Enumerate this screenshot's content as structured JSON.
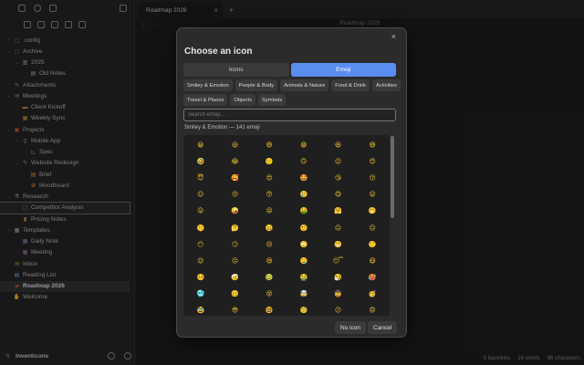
{
  "sidebar": {
    "vault_name": "Inventicons",
    "tree": [
      {
        "label": ".config",
        "arrow": "›",
        "glyph": "▢",
        "color": "#8a8a8a",
        "indent": 0
      },
      {
        "label": "Archive",
        "arrow": "⌄",
        "glyph": "▢",
        "color": "#8a8a8a",
        "indent": 0
      },
      {
        "label": "2025",
        "arrow": "⌄",
        "glyph": "▥",
        "color": "#b8b8b8",
        "indent": 1
      },
      {
        "label": "Old Notes",
        "arrow": "",
        "glyph": "▤",
        "color": "#b8b8b8",
        "indent": 2
      },
      {
        "label": "Attachments",
        "arrow": "›",
        "glyph": "✎",
        "color": "#8ab0d8",
        "indent": 0
      },
      {
        "label": "Meetings",
        "arrow": "⌄",
        "glyph": "✉",
        "color": "#8a9ad8",
        "indent": 0
      },
      {
        "label": "Client Kickoff",
        "arrow": "",
        "glyph": "▬",
        "color": "#d8a040",
        "indent": 1
      },
      {
        "label": "Weekly Sync",
        "arrow": "",
        "glyph": "▦",
        "color": "#d8a040",
        "indent": 1
      },
      {
        "label": "Projects",
        "arrow": "⌄",
        "glyph": "▣",
        "color": "#d86040",
        "indent": 0
      },
      {
        "label": "Mobile App",
        "arrow": "⌄",
        "glyph": "▯",
        "color": "#b8b8b8",
        "indent": 1
      },
      {
        "label": "Spec",
        "arrow": "",
        "glyph": "◺",
        "color": "#8ab0d8",
        "indent": 2
      },
      {
        "label": "Website Redesign",
        "arrow": "⌄",
        "glyph": "✎",
        "color": "#8ab0d8",
        "indent": 1
      },
      {
        "label": "Brief",
        "arrow": "",
        "glyph": "▤",
        "color": "#d8a040",
        "indent": 2
      },
      {
        "label": "Moodboard",
        "arrow": "",
        "glyph": "✿",
        "color": "#d88040",
        "indent": 2
      },
      {
        "label": "Research",
        "arrow": "⌄",
        "glyph": "⚗",
        "color": "#a0c080",
        "indent": 0
      },
      {
        "label": "Competitor Analysis",
        "arrow": "",
        "glyph": "▢",
        "color": "#8a8a8a",
        "indent": 1,
        "state": "selected"
      },
      {
        "label": "Pricing Notes",
        "arrow": "",
        "glyph": "▮",
        "color": "#d8a040",
        "indent": 1
      },
      {
        "label": "Templates",
        "arrow": "⌄",
        "glyph": "▦",
        "color": "#b8b8b8",
        "indent": 0
      },
      {
        "label": "Daily Note",
        "arrow": "",
        "glyph": "▦",
        "color": "#b080c0",
        "indent": 1
      },
      {
        "label": "Meeting",
        "arrow": "",
        "glyph": "▦",
        "color": "#b080c0",
        "indent": 1
      },
      {
        "label": "Inbox",
        "arrow": "",
        "glyph": "✉",
        "color": "#d8a040",
        "indent": 0
      },
      {
        "label": "Reading List",
        "arrow": "",
        "glyph": "▤",
        "color": "#8ab0d8",
        "indent": 0
      },
      {
        "label": "Roadmap 2026",
        "arrow": "",
        "glyph": "▰",
        "color": "#d86040",
        "indent": 0,
        "state": "active"
      },
      {
        "label": "Welcome",
        "arrow": "",
        "glyph": "✋",
        "color": "#d8a040",
        "indent": 0
      }
    ]
  },
  "tabs": {
    "active_tab": "Roadmap 2026",
    "close": "×",
    "new_tab": "+"
  },
  "nav": {
    "back": "‹",
    "forward": "›",
    "breadcrumb": "Roadmap 2026"
  },
  "status": {
    "backlinks": "0 backlinks",
    "words": "16 words",
    "characters": "96 characters"
  },
  "modal": {
    "title": "Choose an icon",
    "close": "×",
    "segments": [
      {
        "label": "Icons",
        "on": false
      },
      {
        "label": "Emoji",
        "on": true
      }
    ],
    "categories": [
      "Smiley & Emotion",
      "People & Body",
      "Animals & Nature",
      "Food & Drink",
      "Activities",
      "Travel & Places",
      "Objects",
      "Symbols"
    ],
    "search_placeholder": "Search emoji...",
    "count_label": "Smiley & Emotion — 141 emoji",
    "emoji": [
      "😀",
      "😃",
      "😄",
      "😁",
      "😆",
      "😅",
      "🤣",
      "😂",
      "🙂",
      "🙃",
      "😉",
      "😊",
      "😇",
      "🥰",
      "😍",
      "🤩",
      "😘",
      "😗",
      "☺",
      "😚",
      "😙",
      "🥲",
      "😋",
      "😛",
      "😜",
      "🤪",
      "😝",
      "🤑",
      "🤗",
      "🤭",
      "🤫",
      "🤔",
      "🤐",
      "🤨",
      "😐",
      "😑",
      "😶",
      "😏",
      "😒",
      "🙄",
      "😬",
      "🤥",
      "😌",
      "😔",
      "😪",
      "🤤",
      "😴",
      "😷",
      "🤒",
      "🤕",
      "🤢",
      "🤮",
      "🤧",
      "🥵",
      "🥶",
      "🥴",
      "😵",
      "🤯",
      "🤠",
      "🥳",
      "🥸",
      "😎",
      "🤓",
      "🧐",
      "😕",
      "😟",
      "🙁",
      "☹",
      "😮",
      "😯",
      "😲",
      "😳",
      "🥺",
      "😦",
      "😧",
      "😨",
      "😰",
      "😥"
    ],
    "buttons": {
      "no_icon": "No icon",
      "cancel": "Cancel"
    }
  }
}
